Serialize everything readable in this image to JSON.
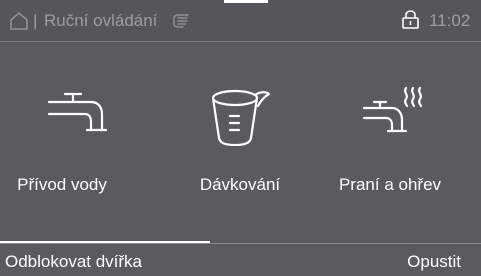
{
  "header": {
    "separator": "|",
    "title": "Ruční ovládání",
    "time": "11:02",
    "icons": [
      "home-icon",
      "manual-hand-icon",
      "lock-icon"
    ]
  },
  "tiles": [
    {
      "label": "Přívod vody",
      "icon": "water-tap-icon"
    },
    {
      "label": "Dávkování",
      "icon": "measuring-cup-icon"
    },
    {
      "label": "Praní a ohřev",
      "icon": "tap-with-steam-icon"
    }
  ],
  "footer": {
    "unlock_label": "Odblokovat dvířka",
    "exit_label": "Opustit"
  },
  "colors": {
    "background": "#5a5b5e",
    "muted_text": "#9c9da0",
    "text": "#ffffff"
  }
}
